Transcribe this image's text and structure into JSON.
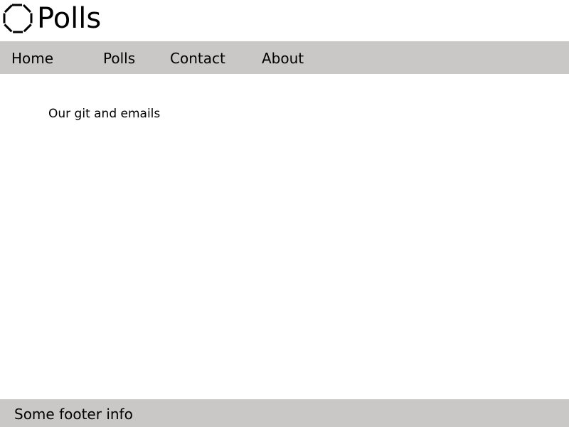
{
  "header": {
    "title": "Polls",
    "logo_icon": "octagon-icon"
  },
  "nav": {
    "items": [
      {
        "label": "Home"
      },
      {
        "label": "Polls"
      },
      {
        "label": "Contact"
      },
      {
        "label": "About"
      }
    ]
  },
  "main": {
    "text": "Our git and emails"
  },
  "footer": {
    "text": "Some footer info"
  },
  "colors": {
    "bar_background": "#c9c8c7",
    "page_background": "#ffffff",
    "text": "#000000"
  }
}
